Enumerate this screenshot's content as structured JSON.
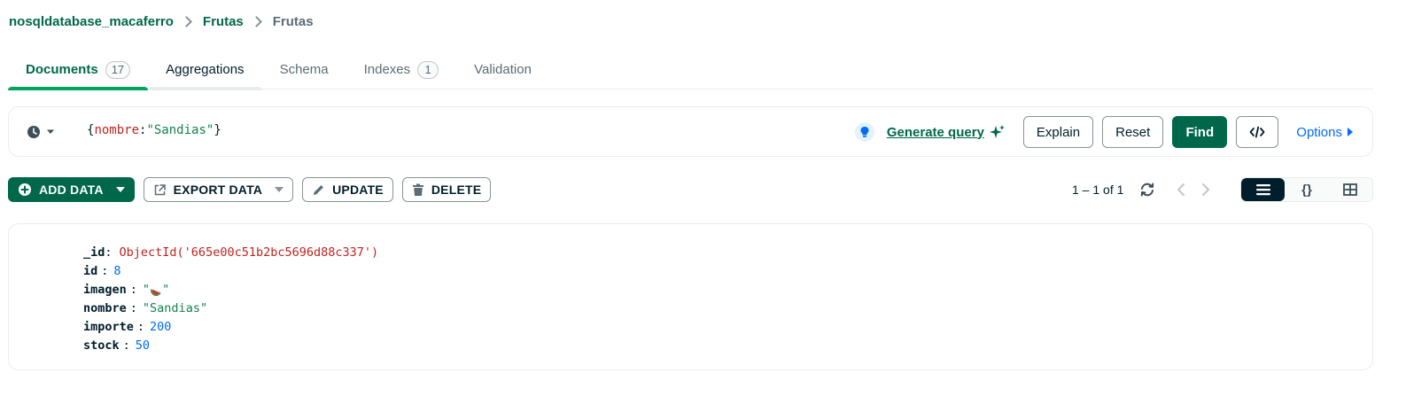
{
  "breadcrumb": {
    "database": "nosqldatabase_macaferro",
    "collection": "Frutas",
    "current": "Frutas"
  },
  "tabs": [
    {
      "label": "Documents",
      "count": "17",
      "active": true
    },
    {
      "label": "Aggregations"
    },
    {
      "label": "Schema"
    },
    {
      "label": "Indexes",
      "count": "1"
    },
    {
      "label": "Validation"
    }
  ],
  "query": {
    "open": "{",
    "key": "nombre",
    "colon": ":",
    "value": "\"Sandias\"",
    "close": "}",
    "generate_label": "Generate query",
    "explain_label": "Explain",
    "reset_label": "Reset",
    "find_label": "Find",
    "options_label": "Options"
  },
  "toolbar": {
    "add_label": "ADD DATA",
    "export_label": "EXPORT DATA",
    "update_label": "UPDATE",
    "delete_label": "DELETE"
  },
  "pagination": {
    "range": "1 – 1 of 1"
  },
  "document": {
    "fields": [
      {
        "key": "_id",
        "value": "ObjectId('665e00c51b2bc5696d88c337')",
        "type": "oid"
      },
      {
        "key": "id",
        "value": "8",
        "type": "num"
      },
      {
        "key": "imagen",
        "value_open": "\"",
        "value_close": "\"",
        "type": "emoji",
        "emoji": "watermelon-icon"
      },
      {
        "key": "nombre",
        "value": "\"Sandias\"",
        "type": "str"
      },
      {
        "key": "importe",
        "value": "200",
        "type": "num"
      },
      {
        "key": "stock",
        "value": "50",
        "type": "num"
      }
    ]
  },
  "colors": {
    "brand_green": "#00684a",
    "accent_green": "#00a35c",
    "link_blue": "#016bf8",
    "key_red": "#c2231f",
    "dark": "#001e2b"
  }
}
